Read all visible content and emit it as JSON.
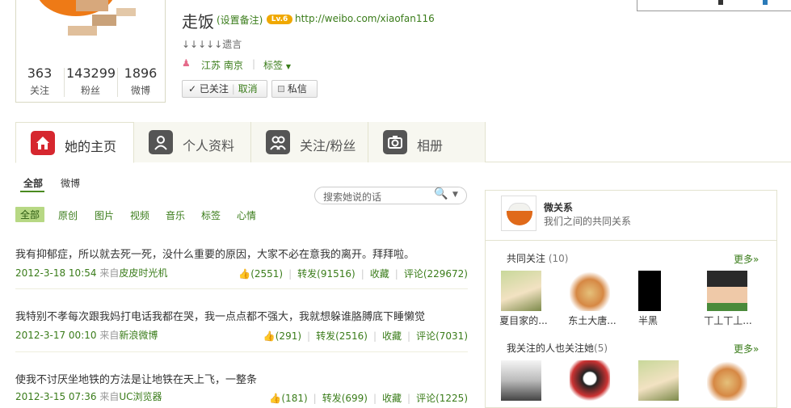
{
  "profile": {
    "name": "走饭",
    "remark": "(设置备注)",
    "vip_badge": "Lv.6",
    "url": "http://weibo.com/xiaofan116",
    "bio": "↓↓↓↓↓遗言",
    "location": "江苏  南京",
    "tags_label": "标签",
    "stats": [
      {
        "num": "363",
        "label": "关注"
      },
      {
        "num": "143299",
        "label": "粉丝"
      },
      {
        "num": "1896",
        "label": "微博"
      }
    ],
    "followed_label": "已关注",
    "cancel_label": "取消",
    "message_label": "私信"
  },
  "tabs": [
    {
      "label": "她的主页",
      "icon": "home-icon"
    },
    {
      "label": "个人资料",
      "icon": "person-icon"
    },
    {
      "label": "关注/粉丝",
      "icon": "people-icon"
    },
    {
      "label": "相册",
      "icon": "camera-icon"
    }
  ],
  "feed_filters": {
    "all": "全部",
    "weibo": "微博"
  },
  "search": {
    "placeholder": "搜索她说的话"
  },
  "subfilters": [
    "全部",
    "原创",
    "图片",
    "视频",
    "音乐",
    "标签",
    "心情"
  ],
  "posts": [
    {
      "text": "我有抑郁症，所以就去死一死，没什么重要的原因，大家不必在意我的离开。拜拜啦。",
      "date": "2012-3-18 10:54",
      "from_label": "来自",
      "source": "皮皮时光机",
      "likes": "(2551)",
      "forward": "转发(91516)",
      "fav": "收藏",
      "comment": "评论(229672)"
    },
    {
      "text": "我特别不孝每次跟我妈打电话我都在哭，我一点点都不强大，我就想躲谁胳膊底下睡懒觉",
      "date": "2012-3-17 00:10",
      "from_label": "来自",
      "source": "新浪微博",
      "likes": "(291)",
      "forward": "转发(2516)",
      "fav": "收藏",
      "comment": "评论(7031)"
    },
    {
      "text": "使我不讨厌坐地铁的方法是让地铁在天上飞，一整条",
      "date": "2012-3-15 07:36",
      "from_label": "来自",
      "source": "UC浏览器",
      "likes": "(181)",
      "forward": "转发(699)",
      "fav": "收藏",
      "comment": "评论(1225)"
    }
  ],
  "relations": {
    "title": "微关系",
    "subtitle": "我们之间的共同关系",
    "mutual_label": "共同关注",
    "mutual_count": "(10)",
    "more": "更多»",
    "mutual": [
      "夏目家的...",
      "东土大唐...",
      "半黑",
      "丅丄丅丄..."
    ],
    "followers_label": "我关注的人也关注她",
    "followers_count": "(5)"
  }
}
